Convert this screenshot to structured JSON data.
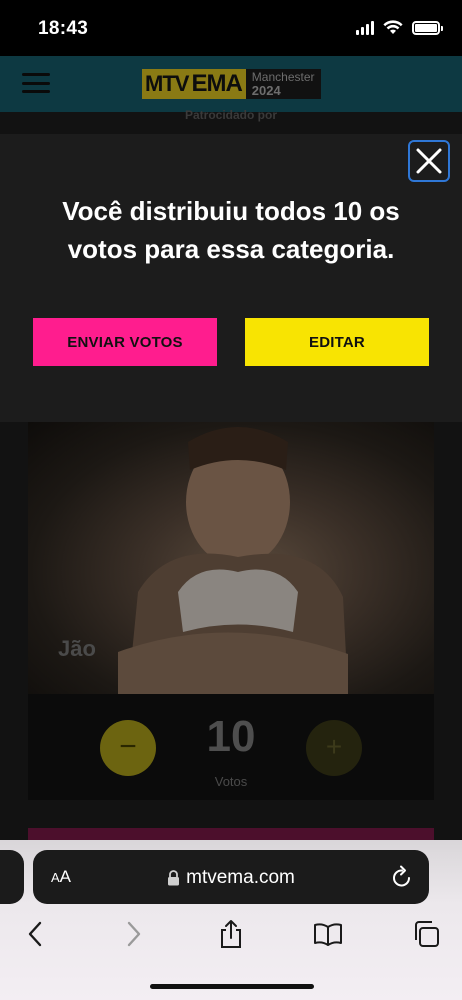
{
  "status_bar": {
    "time": "18:43"
  },
  "header": {
    "logo_mtv": "MTV",
    "logo_ema": "EMA",
    "logo_city": "Manchester",
    "logo_year": "2024"
  },
  "sponsor_text": "Patrocidado por",
  "modal": {
    "title": "Você distribuiu todos 10 os votos para essa categoria.",
    "send_button": "ENVIAR VOTOS",
    "edit_button": "EDITAR"
  },
  "artist": {
    "name": "Jão"
  },
  "vote_panel": {
    "minus_symbol": "−",
    "count": "10",
    "plus_symbol": "+",
    "label": "Votos"
  },
  "browser": {
    "aa_small": "A",
    "aa_large": "A",
    "url": "mtvema.com"
  },
  "colors": {
    "send_button": "#ff1d8e",
    "edit_button": "#f8e402",
    "modal_bg": "#1c1c1c",
    "close_focus": "#2f77d6"
  },
  "icons": [
    "menu-icon",
    "close-icon",
    "lock-icon",
    "reload-icon",
    "back-icon",
    "forward-icon",
    "share-icon",
    "bookmarks-icon",
    "tabs-icon"
  ]
}
